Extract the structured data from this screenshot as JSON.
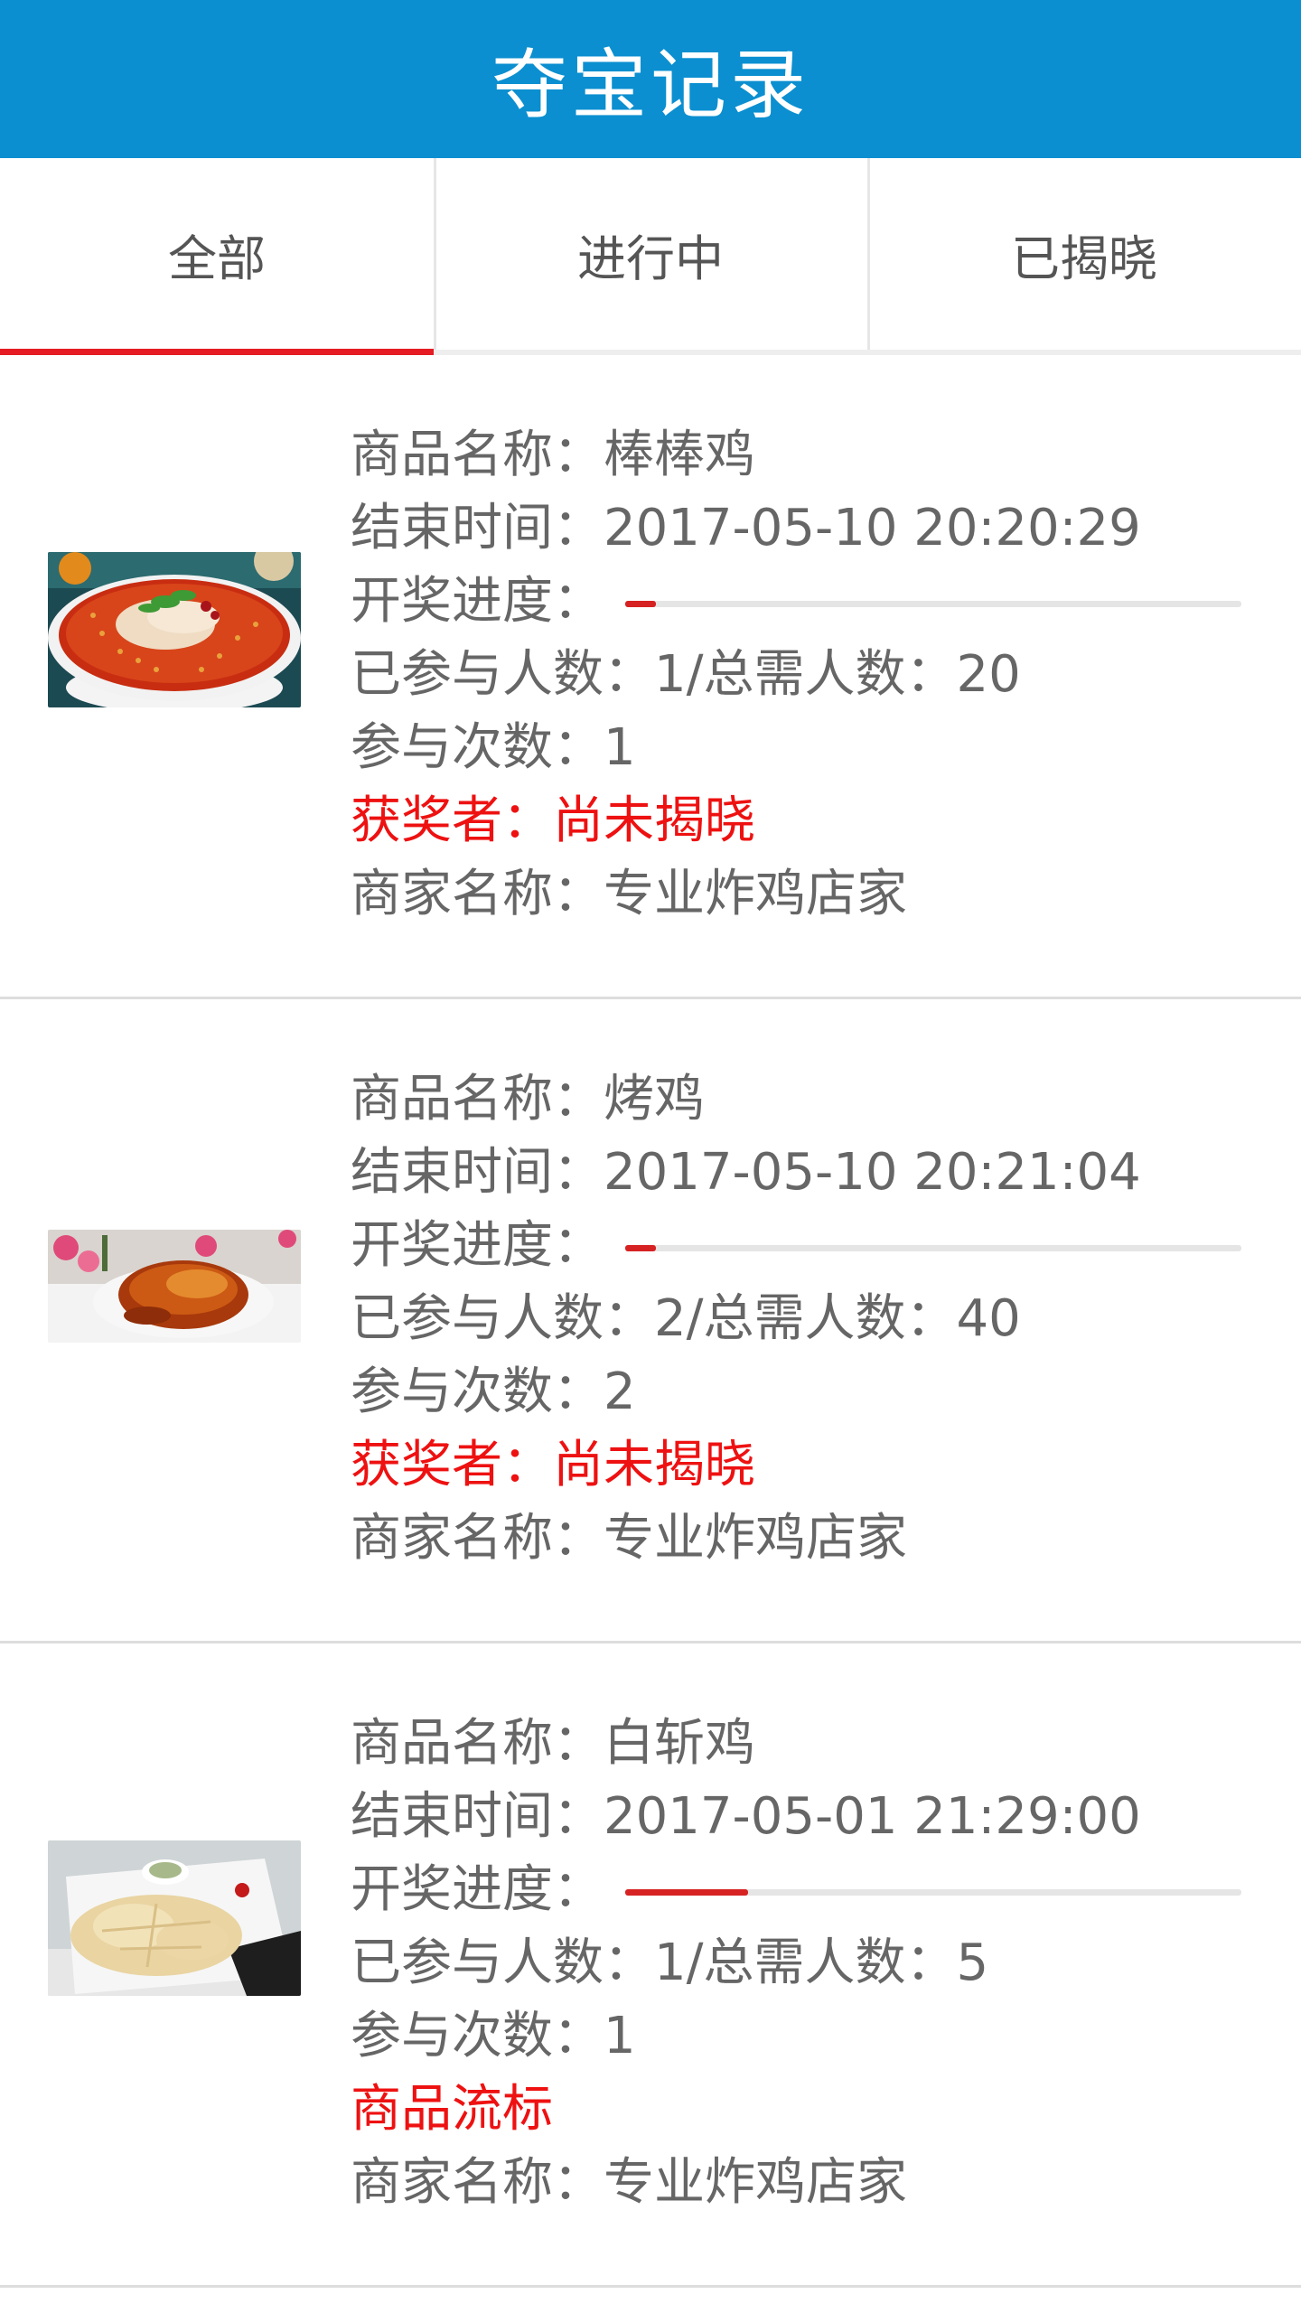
{
  "header": {
    "title": "夺宝记录"
  },
  "tabs": [
    {
      "label": "全部",
      "active": true
    },
    {
      "label": "进行中",
      "active": false
    },
    {
      "label": "已揭晓",
      "active": false
    }
  ],
  "labels": {
    "name": "商品名称：",
    "end_time": "结束时间：",
    "progress": "开奖进度：",
    "joined": "已参与人数：",
    "total_sep": "/总需人数：",
    "times": "参与次数：",
    "merchant": "商家名称："
  },
  "colors": {
    "header_bg": "#0b8fd0",
    "tab_indicator": "#e51c23",
    "status_red": "#ee1111",
    "progress_fill": "#d62222"
  },
  "records": [
    {
      "name": "棒棒鸡",
      "end_time": "2017-05-10 20:20:29",
      "joined": "1",
      "total": "20",
      "progress": 0.05,
      "times": "1",
      "status": "获奖者：尚未揭晓",
      "merchant": "专业炸鸡店家",
      "image": "bangbang-chicken-image"
    },
    {
      "name": "烤鸡",
      "end_time": "2017-05-10 20:21:04",
      "joined": "2",
      "total": "40",
      "progress": 0.05,
      "times": "2",
      "status": "获奖者：尚未揭晓",
      "merchant": "专业炸鸡店家",
      "image": "roast-chicken-image"
    },
    {
      "name": "白斩鸡",
      "end_time": "2017-05-01 21:29:00",
      "joined": "1",
      "total": "5",
      "progress": 0.2,
      "times": "1",
      "status": "商品流标",
      "merchant": "专业炸鸡店家",
      "image": "white-cut-chicken-image"
    }
  ]
}
